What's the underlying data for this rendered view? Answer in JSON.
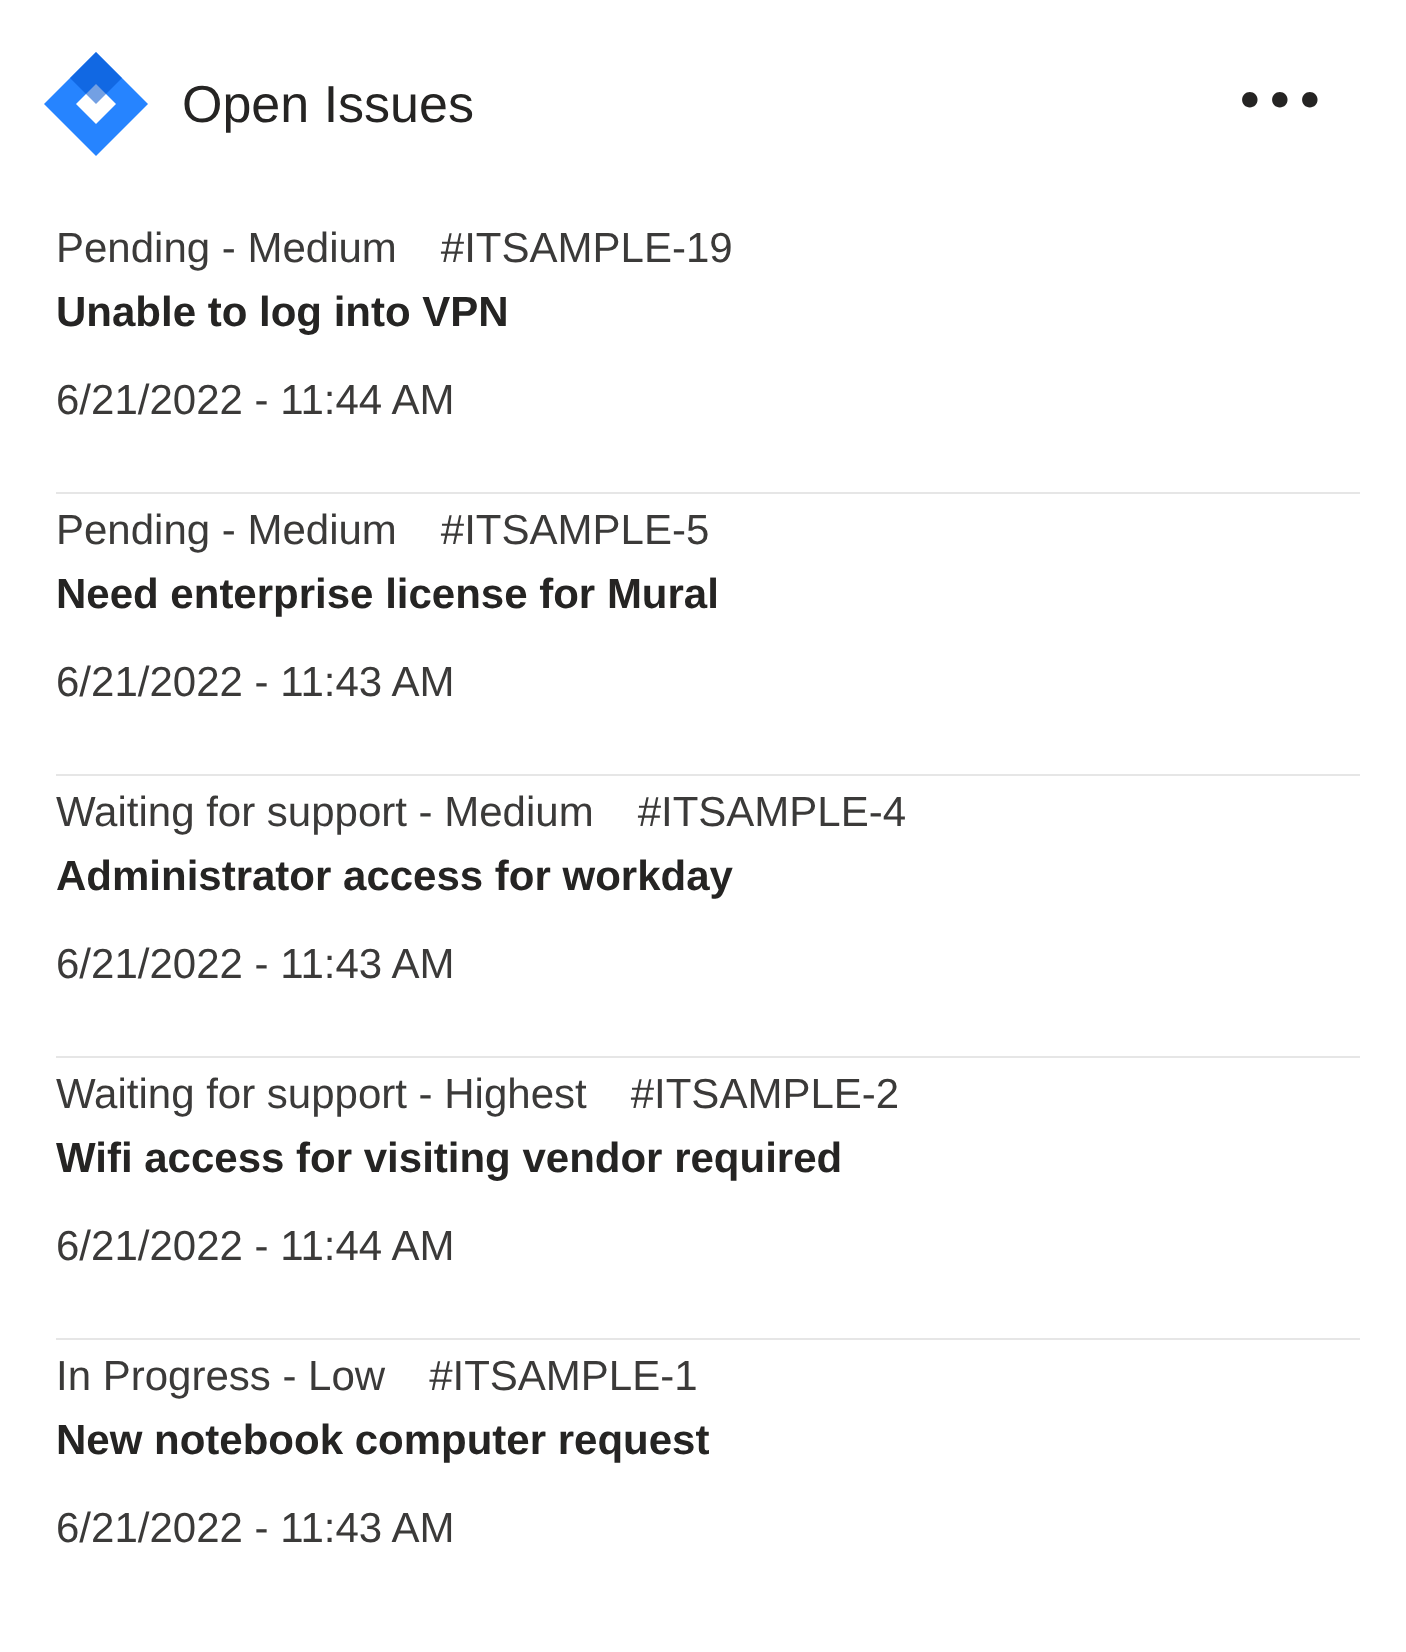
{
  "header": {
    "title": "Open Issues",
    "more_menu": "•••"
  },
  "issues": [
    {
      "status": "Pending - Medium",
      "key": "#ITSAMPLE-19",
      "summary": "Unable to log into VPN",
      "date": "6/21/2022 - 11:44 AM"
    },
    {
      "status": "Pending - Medium",
      "key": "#ITSAMPLE-5",
      "summary": "Need enterprise license for Mural",
      "date": "6/21/2022 - 11:43 AM"
    },
    {
      "status": "Waiting for support - Medium",
      "key": "#ITSAMPLE-4",
      "summary": "Administrator access for workday",
      "date": "6/21/2022 - 11:43 AM"
    },
    {
      "status": "Waiting for support - Highest",
      "key": "#ITSAMPLE-2",
      "summary": "Wifi access for visiting vendor required",
      "date": "6/21/2022 - 11:44 AM"
    },
    {
      "status": "In Progress - Low",
      "key": "#ITSAMPLE-1",
      "summary": "New notebook computer request",
      "date": "6/21/2022 - 11:43 AM"
    }
  ]
}
